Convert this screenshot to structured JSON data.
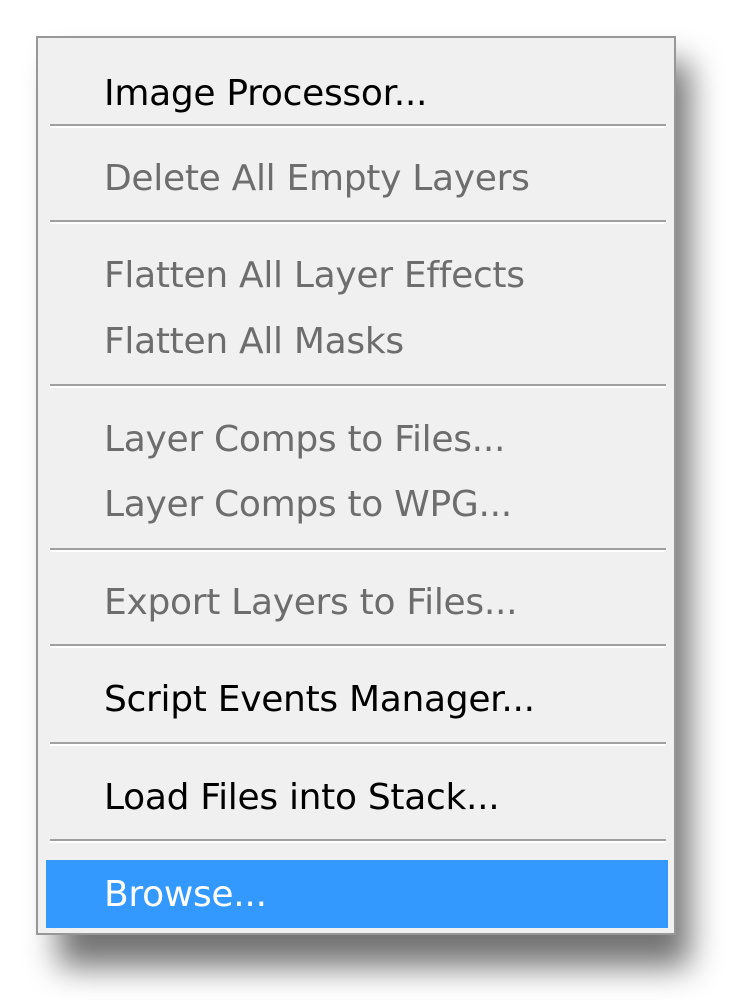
{
  "menu": {
    "items": [
      {
        "label": "Image Processor...",
        "state": "enabled"
      },
      {
        "label": "Delete All Empty Layers",
        "state": "disabled"
      },
      {
        "label": "Flatten All Layer Effects",
        "state": "disabled"
      },
      {
        "label": "Flatten All Masks",
        "state": "disabled"
      },
      {
        "label": "Layer Comps to Files...",
        "state": "disabled"
      },
      {
        "label": "Layer Comps to WPG...",
        "state": "disabled"
      },
      {
        "label": "Export Layers to Files...",
        "state": "disabled"
      },
      {
        "label": "Script Events Manager...",
        "state": "enabled"
      },
      {
        "label": "Load Files into Stack...",
        "state": "enabled"
      },
      {
        "label": "Browse...",
        "state": "selected"
      }
    ],
    "colors": {
      "background": "#f0f0f0",
      "enabled_text": "#000000",
      "disabled_text": "#6d6d6d",
      "highlight": "#3399ff",
      "highlight_text": "#ffffff",
      "separator": "#a0a0a0"
    }
  }
}
